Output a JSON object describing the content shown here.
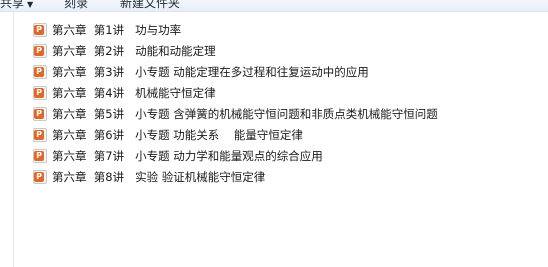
{
  "toolbar": {
    "share_label": "共享",
    "share_arrow": "▼",
    "burn_label": "刻录",
    "newfolder_label": "新建文件夹"
  },
  "files": [
    {
      "name": "第六章  第1讲   功与功率",
      "icon": "ppt-icon",
      "icon_letter": "P"
    },
    {
      "name": "第六章  第2讲   动能和动能定理",
      "icon": "ppt-icon",
      "icon_letter": "P"
    },
    {
      "name": "第六章  第3讲   小专题 动能定理在多过程和往复运动中的应用",
      "icon": "ppt-icon",
      "icon_letter": "P"
    },
    {
      "name": "第六章  第4讲   机械能守恒定律",
      "icon": "ppt-icon",
      "icon_letter": "P"
    },
    {
      "name": "第六章  第5讲   小专题 含弹簧的机械能守恒问题和非质点类机械能守恒问题",
      "icon": "ppt-icon",
      "icon_letter": "P"
    },
    {
      "name": "第六章  第6讲   小专题 功能关系    能量守恒定律",
      "icon": "ppt-icon",
      "icon_letter": "P"
    },
    {
      "name": "第六章  第7讲   小专题 动力学和能量观点的综合应用",
      "icon": "ppt-icon",
      "icon_letter": "P"
    },
    {
      "name": "第六章  第8讲   实验 验证机械能守恒定律",
      "icon": "ppt-icon",
      "icon_letter": "P"
    }
  ],
  "colors": {
    "ppt_icon": "#e0672a",
    "text": "#1a1a1a",
    "toolbar_bg": "#eaf1f8"
  }
}
